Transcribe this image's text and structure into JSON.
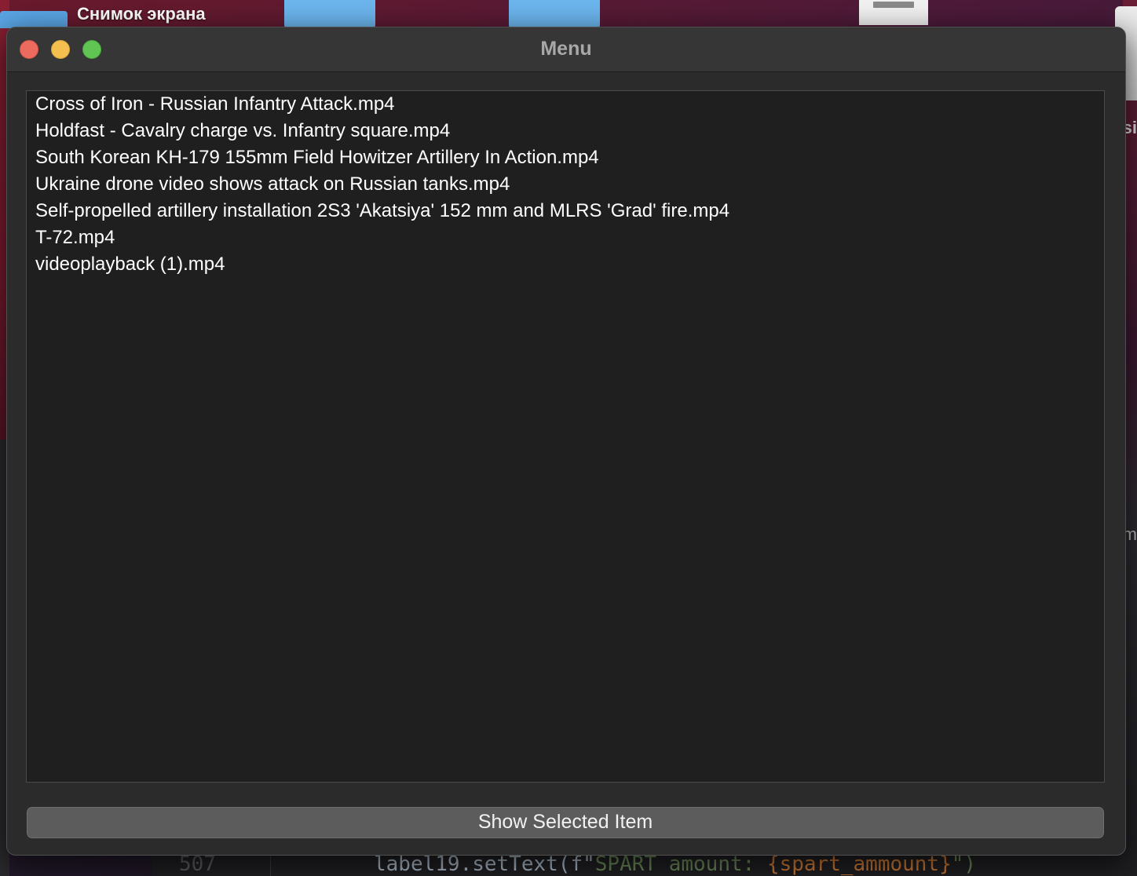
{
  "desktop": {
    "screenshot_label": "Снимок экрана",
    "right_fragment_1": "si",
    "right_fragment_2": "m"
  },
  "background_editor": {
    "line_number": "507",
    "code_prefix": "label19.setText(f\"",
    "code_string_1": "SPART",
    "code_string_2": " amount: ",
    "code_var": "{spart_ammount}",
    "code_suffix": "\")"
  },
  "window": {
    "title": "Menu",
    "items": [
      "Cross of Iron - Russian Infantry Attack.mp4",
      "Holdfast - Cavalry charge vs. Infantry square.mp4",
      "South Korean KH-179 155mm Field Howitzer Artillery In Action.mp4",
      "Ukraine drone video shows attack on Russian tanks.mp4",
      "Self-propelled artillery installation 2S3 'Akatsiya' 152 mm and MLRS 'Grad' fire.mp4",
      "T-72.mp4",
      "videoplayback (1).mp4"
    ],
    "button_label": "Show Selected Item"
  },
  "colors": {
    "window_bg": "#2b2b2b",
    "list_bg": "#1f1f1f",
    "button_bg": "#5c5c5c",
    "close": "#ec6a5e",
    "minimize": "#f4bf4f",
    "zoom": "#61c554"
  }
}
